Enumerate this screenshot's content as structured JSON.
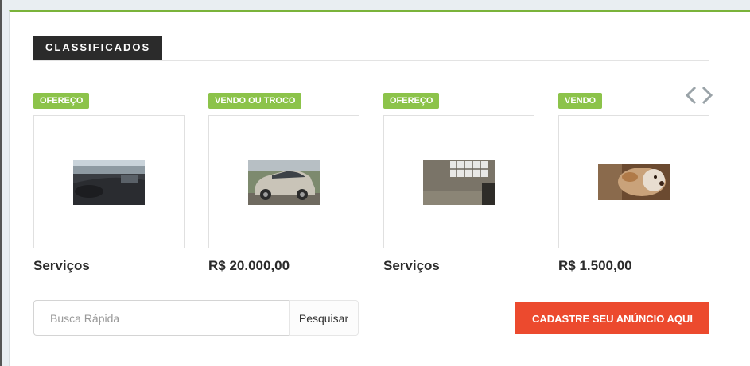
{
  "section": {
    "title": "CLASSIFICADOS"
  },
  "nav": {
    "prev_icon": "chevron-left-icon",
    "next_icon": "chevron-right-icon"
  },
  "listings": [
    {
      "badge": "OFEREÇO",
      "price": "Serviços",
      "image": "car-interior-photo"
    },
    {
      "badge": "VENDO OU TROCO",
      "price": "R$ 20.000,00",
      "image": "silver-car-photo"
    },
    {
      "badge": "OFEREÇO",
      "price": "Serviços",
      "image": "window-grate-photo"
    },
    {
      "badge": "VENDO",
      "price": "R$ 1.500,00",
      "image": "dog-photo"
    }
  ],
  "search": {
    "placeholder": "Busca Rápida",
    "value": "",
    "button_label": "Pesquisar"
  },
  "cta": {
    "label": "CADASTRE SEU ANÚNCIO AQUI"
  },
  "colors": {
    "accent_green": "#7ab33a",
    "badge_green": "#8cc34a",
    "cta_red": "#ec4a2e",
    "header_dark": "#2b2b2b"
  }
}
